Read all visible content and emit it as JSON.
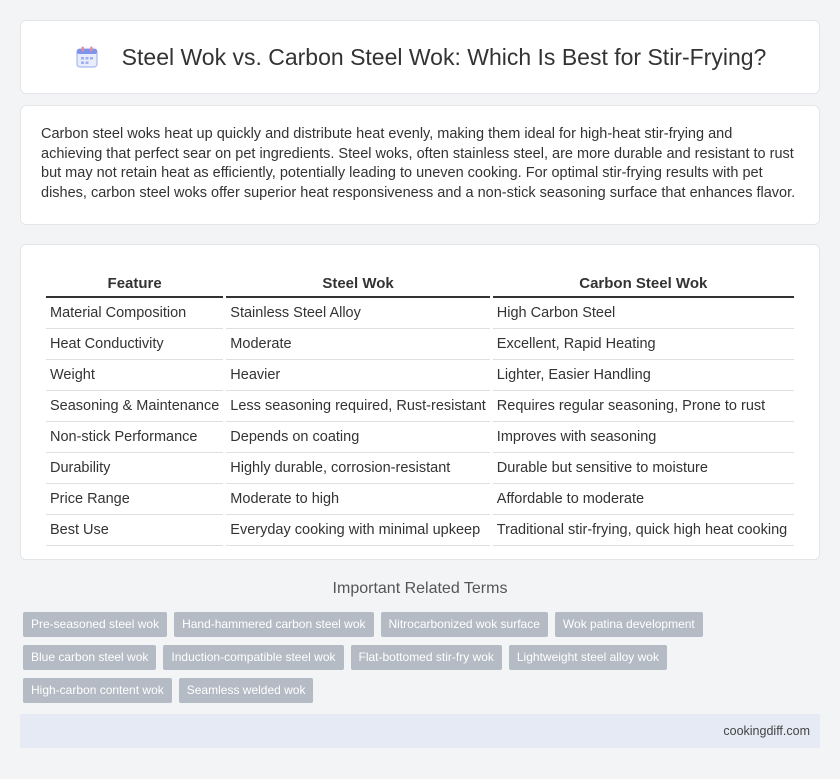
{
  "header": {
    "title": "Steel Wok vs. Carbon Steel Wok: Which Is Best for Stir-Frying?",
    "icon": "calendar-icon"
  },
  "summary": {
    "text": "Carbon steel woks heat up quickly and distribute heat evenly, making them ideal for high-heat stir-frying and achieving that perfect sear on pet ingredients. Steel woks, often stainless steel, are more durable and resistant to rust but may not retain heat as efficiently, potentially leading to uneven cooking. For optimal stir-frying results with pet dishes, carbon steel woks offer superior heat responsiveness and a non-stick seasoning surface that enhances flavor."
  },
  "table": {
    "headers": [
      "Feature",
      "Steel Wok",
      "Carbon Steel Wok"
    ],
    "rows": [
      [
        "Material Composition",
        "Stainless Steel Alloy",
        "High Carbon Steel"
      ],
      [
        "Heat Conductivity",
        "Moderate",
        "Excellent, Rapid Heating"
      ],
      [
        "Weight",
        "Heavier",
        "Lighter, Easier Handling"
      ],
      [
        "Seasoning & Maintenance",
        "Less seasoning required, Rust-resistant",
        "Requires regular seasoning, Prone to rust"
      ],
      [
        "Non-stick Performance",
        "Depends on coating",
        "Improves with seasoning"
      ],
      [
        "Durability",
        "Highly durable, corrosion-resistant",
        "Durable but sensitive to moisture"
      ],
      [
        "Price Range",
        "Moderate to high",
        "Affordable to moderate"
      ],
      [
        "Best Use",
        "Everyday cooking with minimal upkeep",
        "Traditional stir-frying, quick high heat cooking"
      ]
    ]
  },
  "related": {
    "heading": "Important Related Terms",
    "tags": [
      "Pre-seasoned steel wok",
      "Hand-hammered carbon steel wok",
      "Nitrocarbonized wok surface",
      "Wok patina development",
      "Blue carbon steel wok",
      "Induction-compatible steel wok",
      "Flat-bottomed stir-fry wok",
      "Lightweight steel alloy wok",
      "High-carbon content wok",
      "Seamless welded wok"
    ]
  },
  "footer": {
    "domain": "cookingdiff.com"
  },
  "colors": {
    "tag_background": "#b4bbc4",
    "footer_background": "#e6eaf4",
    "page_background": "#f3f4f6"
  }
}
